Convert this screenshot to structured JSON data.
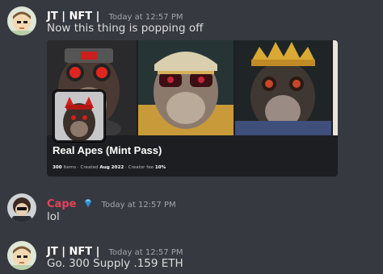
{
  "messages": [
    {
      "author": "JT | NFT |",
      "timestamp": "Today at 12:57 PM",
      "text": "Now this thing is popping off"
    },
    {
      "author": "Cape",
      "timestamp": "Today at 12:57 PM",
      "text": "lol",
      "badge_icon": "gem-icon"
    },
    {
      "author": "JT | NFT |",
      "timestamp": "Today at 12:57 PM",
      "text": "Go. 300 Supply .159 ETH"
    }
  ],
  "embed": {
    "title": "Real Apes (Mint Pass)",
    "items_value": "300",
    "items_label": "Items",
    "created_label": "Created",
    "created_value": "Aug 2022",
    "fee_label": "Creator fee",
    "fee_value": "10%",
    "separator": "·"
  },
  "colors": {
    "background": "#36393f",
    "embed_background": "#1d1e22",
    "cape_name": "#e8415a",
    "timestamp": "#a3a6aa"
  }
}
